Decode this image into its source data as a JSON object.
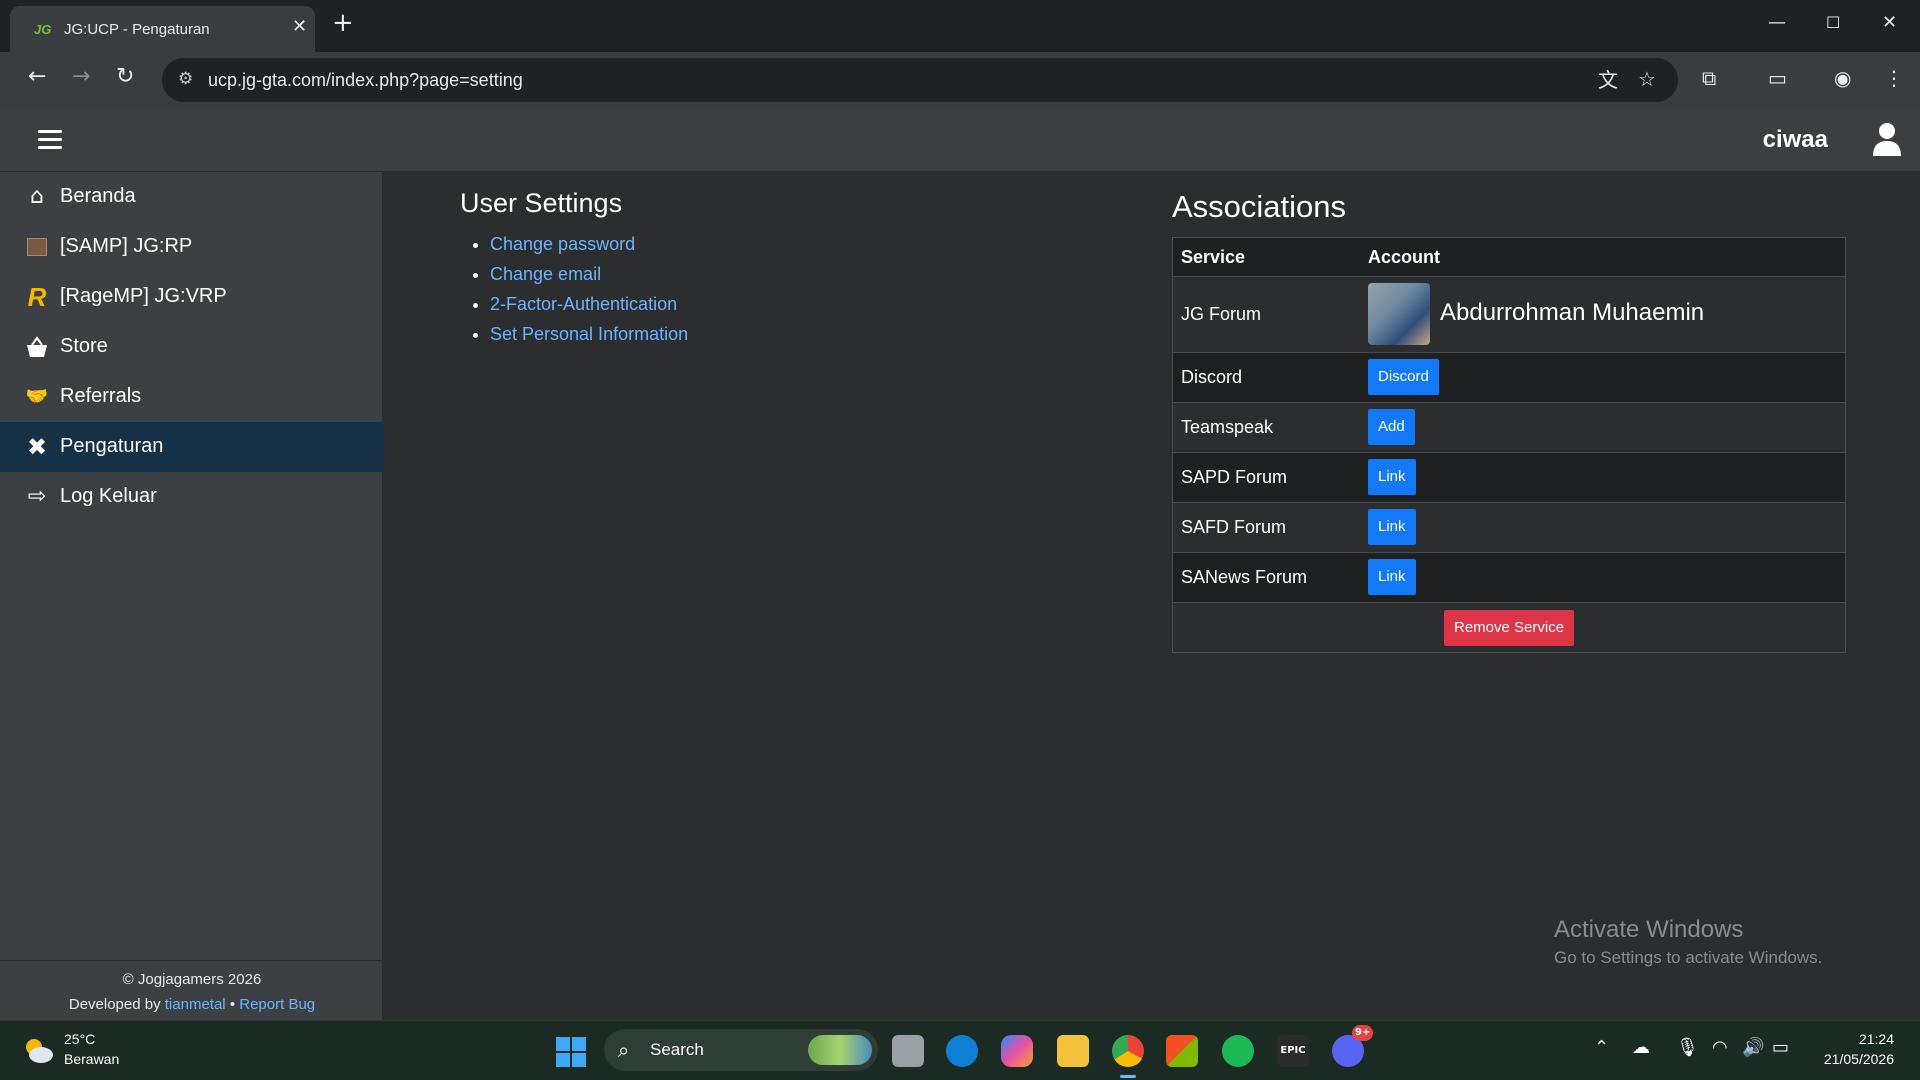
{
  "browser": {
    "tab_title": "JG:UCP - Pengaturan",
    "tab_favicon": "JG",
    "url": "ucp.jg-gta.com/index.php?page=setting"
  },
  "header": {
    "username": "ciwaa"
  },
  "sidebar": {
    "items": [
      {
        "label": "Beranda",
        "icon": "home-icon"
      },
      {
        "label": "[SAMP] JG:RP",
        "icon": "samp-logo-icon"
      },
      {
        "label": "[RageMP] JG:VRP",
        "icon": "ragemp-logo-icon"
      },
      {
        "label": "Store",
        "icon": "basket-icon"
      },
      {
        "label": "Referrals",
        "icon": "handshake-icon"
      },
      {
        "label": "Pengaturan",
        "icon": "tools-icon",
        "active": true
      },
      {
        "label": "Log Keluar",
        "icon": "sign-out-icon"
      }
    ],
    "footer": {
      "copyright": "© Jogjagamers 2026",
      "developed_by": "Developed by",
      "developer": "tianmetal",
      "separator": "•",
      "report_bug": "Report Bug"
    }
  },
  "settings": {
    "title": "User Settings",
    "links": [
      "Change password",
      "Change email",
      "2-Factor-Authentication",
      "Set Personal Information"
    ]
  },
  "associations": {
    "title": "Associations",
    "columns": [
      "Service",
      "Account"
    ],
    "rows": [
      {
        "service": "JG Forum",
        "account": "Abdurrohman Muhaemin",
        "type": "avatar"
      },
      {
        "service": "Discord",
        "button": "Discord"
      },
      {
        "service": "Teamspeak",
        "button": "Add"
      },
      {
        "service": "SAPD Forum",
        "button": "Link"
      },
      {
        "service": "SAFD Forum",
        "button": "Link"
      },
      {
        "service": "SANews Forum",
        "button": "Link"
      }
    ],
    "remove_button": "Remove Service"
  },
  "watermark": {
    "line1": "Activate Windows",
    "line2": "Go to Settings to activate Windows."
  },
  "taskbar": {
    "temp": "25°C",
    "weather": "Berawan",
    "search": "Search",
    "time": "21:24",
    "date": "21/05/2026",
    "epic_label": "EPIC",
    "discord_badge": "9+"
  },
  "colors": {
    "accent_blue": "#1479f6",
    "danger_red": "#dc3545",
    "link_blue": "#6cb4ff",
    "active_nav": "#163045"
  }
}
